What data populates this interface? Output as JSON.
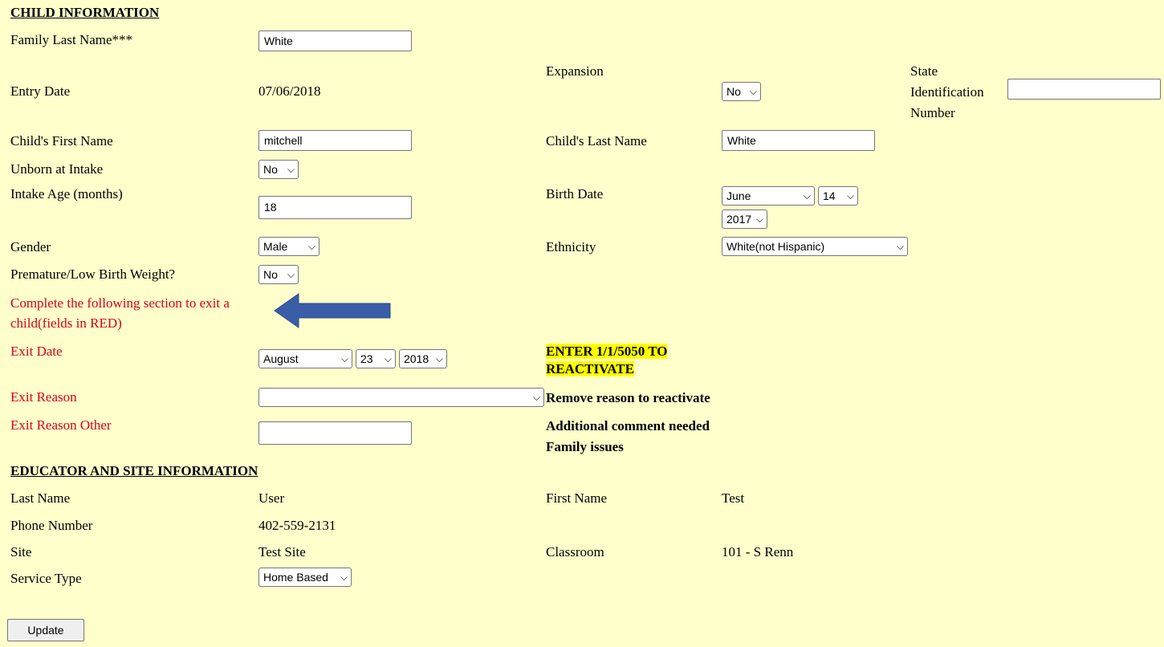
{
  "child_section": {
    "title": "CHILD INFORMATION",
    "family_last_name_label": "Family Last Name***",
    "family_last_name_value": "White",
    "entry_date_label": "Entry Date",
    "entry_date_value": "07/06/2018",
    "expansion_label": "Expansion",
    "expansion_value": "No",
    "state_id_label_1": "State",
    "state_id_label_2": "Identification",
    "state_id_label_3": "Number",
    "state_id_value": "",
    "child_first_name_label": "Child's First Name",
    "child_first_name_value": "mitchell",
    "child_last_name_label": "Child's Last Name",
    "child_last_name_value": "White",
    "unborn_label": "Unborn at Intake",
    "unborn_value": "No",
    "intake_age_label": "Intake Age (months)",
    "intake_age_value": "18",
    "birth_date_label": "Birth Date",
    "birth_month": "June",
    "birth_day": "14",
    "birth_year": "2017",
    "gender_label": "Gender",
    "gender_value": "Male",
    "ethnicity_label": "Ethnicity",
    "ethnicity_value": "White(not Hispanic)",
    "premature_label": "Premature/Low Birth Weight?",
    "premature_value": "No"
  },
  "exit_section": {
    "instruction_1": "Complete the following section to exit a",
    "instruction_2": "child(fields in RED)",
    "exit_date_label": "Exit Date",
    "exit_month": "August",
    "exit_day": "23",
    "exit_year": "2018",
    "reactivate_note_1": "ENTER 1/1/5050 TO",
    "reactivate_note_2": "REACTIVATE",
    "exit_reason_label": "Exit Reason",
    "exit_reason_value": "",
    "remove_reason_note": "Remove reason to reactivate",
    "exit_reason_other_label": "Exit Reason Other",
    "exit_reason_other_value": "",
    "additional_comment_note": "Additional comment needed",
    "family_issues_note": "Family issues"
  },
  "educator_section": {
    "title": "EDUCATOR AND SITE INFORMATION",
    "last_name_label": "Last Name",
    "last_name_value": "User",
    "first_name_label": "First Name",
    "first_name_value": "Test",
    "phone_label": "Phone Number",
    "phone_value": "402-559-2131",
    "site_label": "Site",
    "site_value": "Test Site",
    "classroom_label": "Classroom",
    "classroom_value": "101 - S Renn",
    "service_type_label": "Service Type",
    "service_type_value": "Home Based"
  },
  "actions": {
    "update_label": "Update"
  },
  "colors": {
    "background": "#ffffcc",
    "red_label": "#d8001c",
    "highlight": "#ffff00",
    "arrow": "#3a5da8"
  },
  "icons": {
    "dropdown": "chevron-down-icon",
    "pointer": "arrow-left-icon"
  }
}
